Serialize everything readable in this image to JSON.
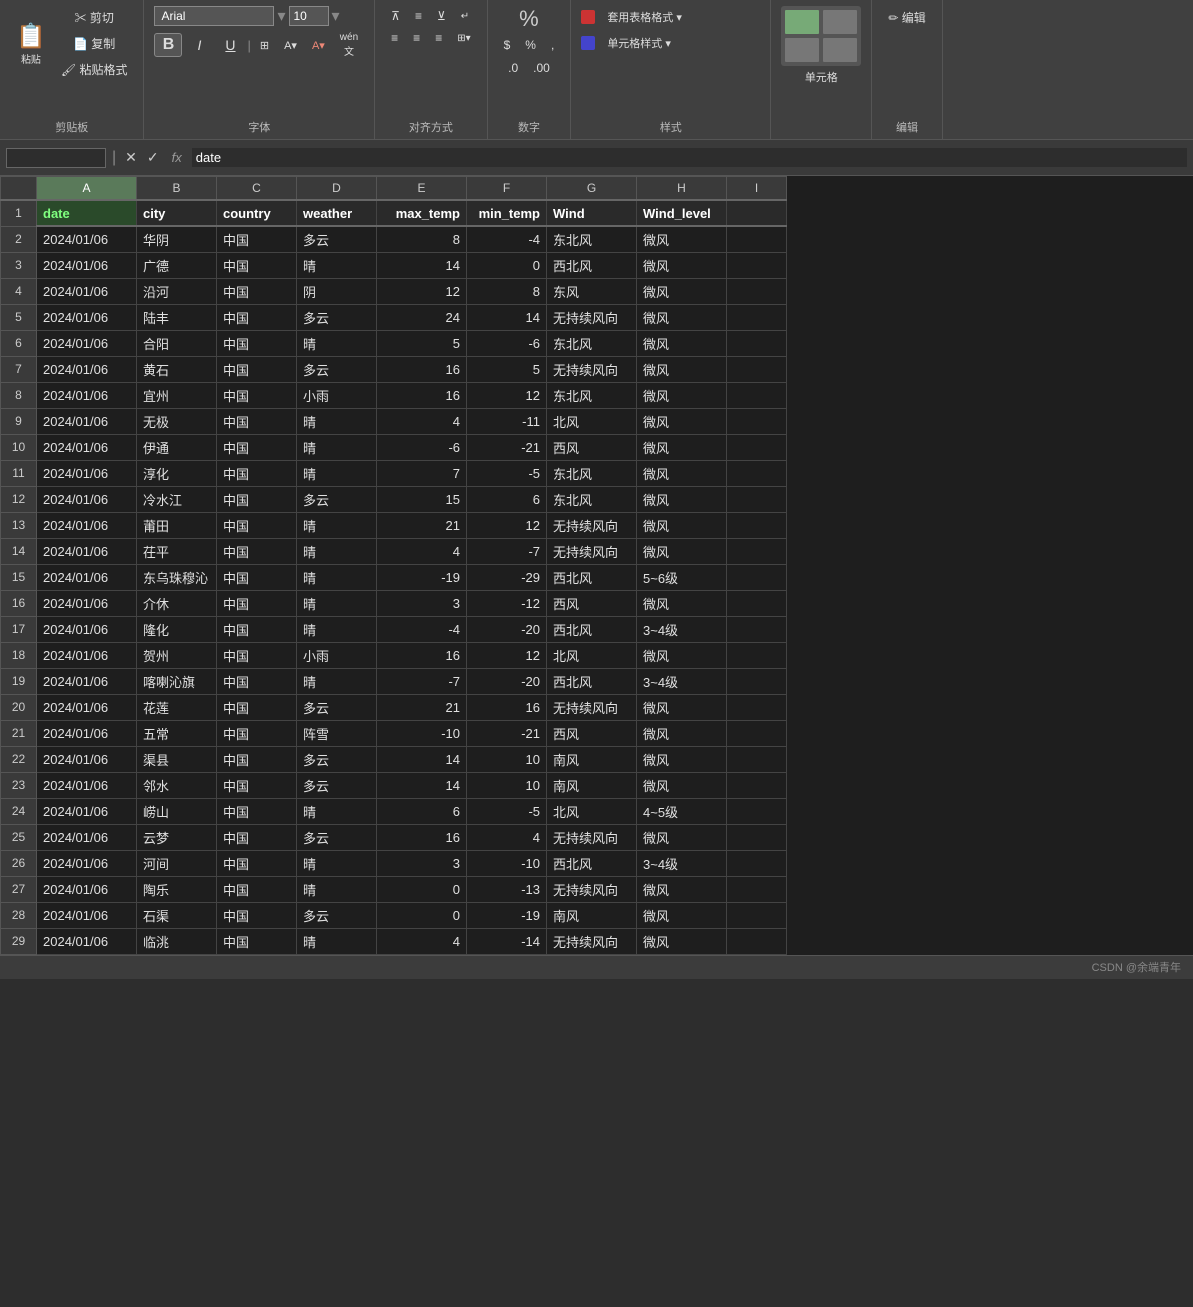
{
  "toolbar": {
    "font_name": "Arial",
    "font_size": "10",
    "bold": "B",
    "italic": "I",
    "underline": "U",
    "sections": {
      "clipboard_label": "剪贴板",
      "font_label": "字体",
      "align_label": "对齐方式",
      "number_label": "数字",
      "styles_label": "样式",
      "cell_label": "单元格",
      "edit_label": "编辑"
    },
    "styles_btns": [
      "套用表格格式 ▾",
      "单元格样式 ▾"
    ],
    "cell_btn": "单元格",
    "percent_symbol": "%"
  },
  "formula_bar": {
    "cell_ref": "",
    "formula_text": "date",
    "fx": "fx"
  },
  "spreadsheet": {
    "col_headers": [
      "A",
      "B",
      "C",
      "D",
      "E",
      "F",
      "G",
      "H",
      "I"
    ],
    "headers": {
      "A": "date",
      "B": "city",
      "C": "country",
      "D": "weather",
      "E": "max_temp",
      "F": "min_temp",
      "G": "Wind",
      "H": "Wind_level",
      "I": ""
    },
    "rows": [
      {
        "A": "2024/01/06",
        "B": "华阴",
        "C": "中国",
        "D": "多云",
        "E": "8",
        "F": "-4",
        "G": "东北风",
        "H": "微风"
      },
      {
        "A": "2024/01/06",
        "B": "广德",
        "C": "中国",
        "D": "晴",
        "E": "14",
        "F": "0",
        "G": "西北风",
        "H": "微风"
      },
      {
        "A": "2024/01/06",
        "B": "沿河",
        "C": "中国",
        "D": "阴",
        "E": "12",
        "F": "8",
        "G": "东风",
        "H": "微风"
      },
      {
        "A": "2024/01/06",
        "B": "陆丰",
        "C": "中国",
        "D": "多云",
        "E": "24",
        "F": "14",
        "G": "无持续风向",
        "H": "微风"
      },
      {
        "A": "2024/01/06",
        "B": "合阳",
        "C": "中国",
        "D": "晴",
        "E": "5",
        "F": "-6",
        "G": "东北风",
        "H": "微风"
      },
      {
        "A": "2024/01/06",
        "B": "黄石",
        "C": "中国",
        "D": "多云",
        "E": "16",
        "F": "5",
        "G": "无持续风向",
        "H": "微风"
      },
      {
        "A": "2024/01/06",
        "B": "宜州",
        "C": "中国",
        "D": "小雨",
        "E": "16",
        "F": "12",
        "G": "东北风",
        "H": "微风"
      },
      {
        "A": "2024/01/06",
        "B": "无极",
        "C": "中国",
        "D": "晴",
        "E": "4",
        "F": "-11",
        "G": "北风",
        "H": "微风"
      },
      {
        "A": "2024/01/06",
        "B": "伊通",
        "C": "中国",
        "D": "晴",
        "E": "-6",
        "F": "-21",
        "G": "西风",
        "H": "微风"
      },
      {
        "A": "2024/01/06",
        "B": "淳化",
        "C": "中国",
        "D": "晴",
        "E": "7",
        "F": "-5",
        "G": "东北风",
        "H": "微风"
      },
      {
        "A": "2024/01/06",
        "B": "冷水江",
        "C": "中国",
        "D": "多云",
        "E": "15",
        "F": "6",
        "G": "东北风",
        "H": "微风"
      },
      {
        "A": "2024/01/06",
        "B": "莆田",
        "C": "中国",
        "D": "晴",
        "E": "21",
        "F": "12",
        "G": "无持续风向",
        "H": "微风"
      },
      {
        "A": "2024/01/06",
        "B": "茌平",
        "C": "中国",
        "D": "晴",
        "E": "4",
        "F": "-7",
        "G": "无持续风向",
        "H": "微风"
      },
      {
        "A": "2024/01/06",
        "B": "东乌珠穆沁",
        "C": "中国",
        "D": "晴",
        "E": "-19",
        "F": "-29",
        "G": "西北风",
        "H": "5~6级"
      },
      {
        "A": "2024/01/06",
        "B": "介休",
        "C": "中国",
        "D": "晴",
        "E": "3",
        "F": "-12",
        "G": "西风",
        "H": "微风"
      },
      {
        "A": "2024/01/06",
        "B": "隆化",
        "C": "中国",
        "D": "晴",
        "E": "-4",
        "F": "-20",
        "G": "西北风",
        "H": "3~4级"
      },
      {
        "A": "2024/01/06",
        "B": "贺州",
        "C": "中国",
        "D": "小雨",
        "E": "16",
        "F": "12",
        "G": "北风",
        "H": "微风"
      },
      {
        "A": "2024/01/06",
        "B": "喀喇沁旗",
        "C": "中国",
        "D": "晴",
        "E": "-7",
        "F": "-20",
        "G": "西北风",
        "H": "3~4级"
      },
      {
        "A": "2024/01/06",
        "B": "花莲",
        "C": "中国",
        "D": "多云",
        "E": "21",
        "F": "16",
        "G": "无持续风向",
        "H": "微风"
      },
      {
        "A": "2024/01/06",
        "B": "五常",
        "C": "中国",
        "D": "阵雪",
        "E": "-10",
        "F": "-21",
        "G": "西风",
        "H": "微风"
      },
      {
        "A": "2024/01/06",
        "B": "渠县",
        "C": "中国",
        "D": "多云",
        "E": "14",
        "F": "10",
        "G": "南风",
        "H": "微风"
      },
      {
        "A": "2024/01/06",
        "B": "邻水",
        "C": "中国",
        "D": "多云",
        "E": "14",
        "F": "10",
        "G": "南风",
        "H": "微风"
      },
      {
        "A": "2024/01/06",
        "B": "崂山",
        "C": "中国",
        "D": "晴",
        "E": "6",
        "F": "-5",
        "G": "北风",
        "H": "4~5级"
      },
      {
        "A": "2024/01/06",
        "B": "云梦",
        "C": "中国",
        "D": "多云",
        "E": "16",
        "F": "4",
        "G": "无持续风向",
        "H": "微风"
      },
      {
        "A": "2024/01/06",
        "B": "河间",
        "C": "中国",
        "D": "晴",
        "E": "3",
        "F": "-10",
        "G": "西北风",
        "H": "3~4级"
      },
      {
        "A": "2024/01/06",
        "B": "陶乐",
        "C": "中国",
        "D": "晴",
        "E": "0",
        "F": "-13",
        "G": "无持续风向",
        "H": "微风"
      },
      {
        "A": "2024/01/06",
        "B": "石渠",
        "C": "中国",
        "D": "多云",
        "E": "0",
        "F": "-19",
        "G": "南风",
        "H": "微风"
      },
      {
        "A": "2024/01/06",
        "B": "临洮",
        "C": "中国",
        "D": "晴",
        "E": "4",
        "F": "-14",
        "G": "无持续风向",
        "H": "微风"
      }
    ]
  },
  "status_bar": {
    "watermark": "CSDN @余端青年"
  }
}
